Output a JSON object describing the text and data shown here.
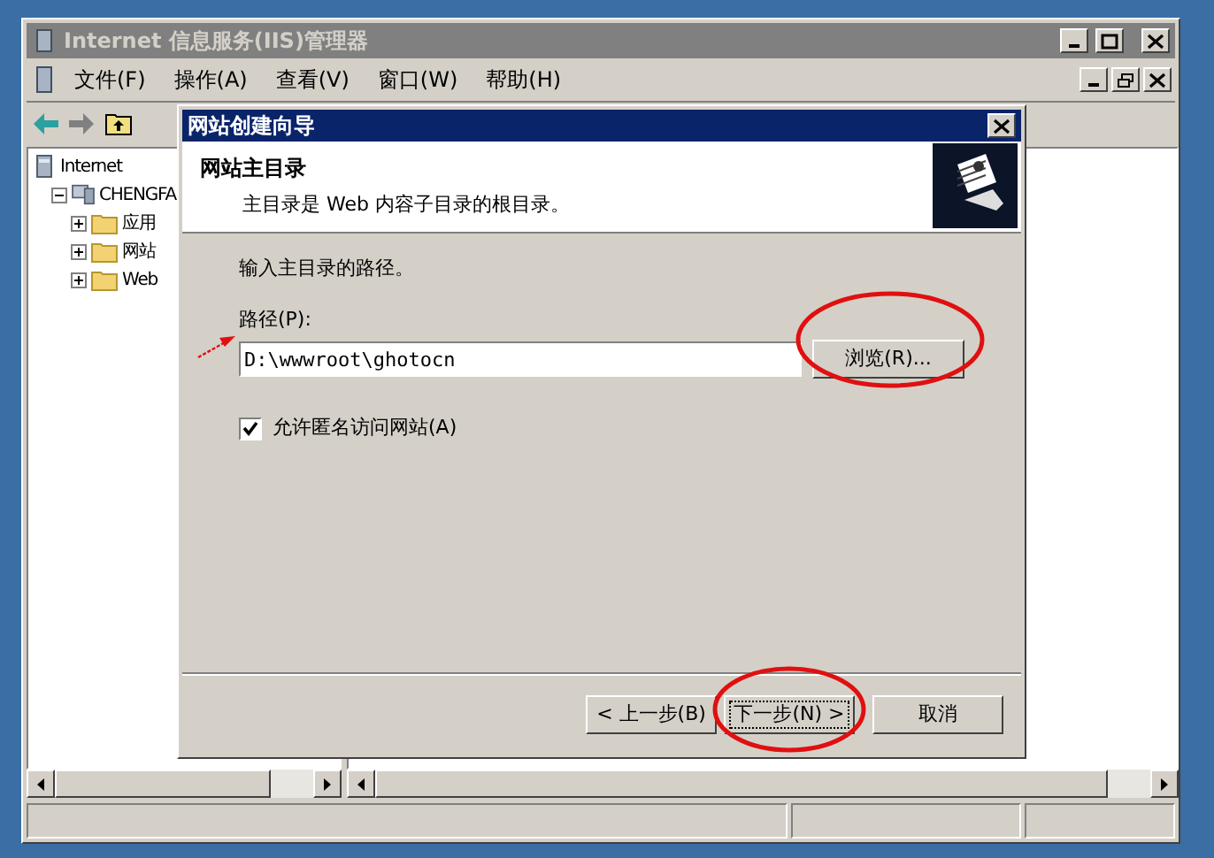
{
  "window": {
    "title": "Internet 信息服务(IIS)管理器"
  },
  "menu": [
    {
      "label": "文件(F)"
    },
    {
      "label": "操作(A)"
    },
    {
      "label": "查看(V)"
    },
    {
      "label": "窗口(W)"
    },
    {
      "label": "帮助(H)"
    }
  ],
  "tree": [
    {
      "label": "Internet",
      "children": [
        {
          "label": "CHENGFA",
          "expanded": true,
          "children": [
            {
              "label": "应用",
              "expanded": false
            },
            {
              "label": "网站",
              "expanded": false
            },
            {
              "label": "Web",
              "expanded": false
            }
          ]
        }
      ]
    }
  ],
  "dialog": {
    "title": "网站创建向导",
    "heading": "网站主目录",
    "subheading": "主目录是 Web 内容子目录的根目录。",
    "prompt": "输入主目录的路径。",
    "path_label": "路径(P):",
    "path_value": "D:\\wwwroot\\ghotocn",
    "browse_button": "浏览(R)...",
    "anonymous": {
      "label": "允许匿名访问网站(A)",
      "checked": true
    },
    "buttons": [
      {
        "label": "< 上一步(B)",
        "focused": false
      },
      {
        "label": "下一步(N) >",
        "focused": true
      },
      {
        "label": "取消",
        "focused": false
      }
    ]
  }
}
